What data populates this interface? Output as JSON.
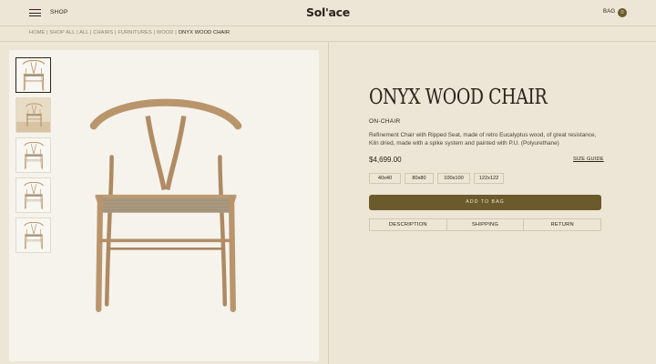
{
  "header": {
    "menu_icon": "hamburger-menu-icon",
    "shop_label": "SHOP",
    "logo": "Sol'ace",
    "bag_label": "BAG",
    "bag_count": "0"
  },
  "breadcrumb": {
    "items": [
      "HOME",
      "SHOP ALL",
      "ALL",
      "CHAIRS",
      "FURNITURES",
      "WOOD"
    ],
    "separator": " | ",
    "current": "ONYX WOOD CHAIR"
  },
  "gallery": {
    "thumbnails": [
      {
        "name": "thumb-front",
        "active": true
      },
      {
        "name": "thumb-room",
        "active": false
      },
      {
        "name": "thumb-angle",
        "active": false
      },
      {
        "name": "thumb-side",
        "active": false
      },
      {
        "name": "thumb-back",
        "active": false
      }
    ]
  },
  "product": {
    "title": "ONYX WOOD CHAIR",
    "brand": "ON-CHAIR",
    "description": "Refinement Chair with Ripped Seat, made of retro Eucalyptus wood, of great resistance, Kiln dried, made with a spike system and painted with P.U. (Polyurethane)",
    "price": "$4,699.00",
    "size_guide_label": "SIZE GUIDE",
    "sizes": [
      "40x40",
      "80x80",
      "100x100",
      "122x122"
    ],
    "add_to_bag_label": "ADD TO BAG",
    "tabs": [
      "DESCRIPTION",
      "SHIPPING",
      "RETURN"
    ]
  },
  "colors": {
    "background": "#ede6d6",
    "accent": "#6b5a2b",
    "wood": "#b48f67",
    "cord": "#a8987e"
  }
}
